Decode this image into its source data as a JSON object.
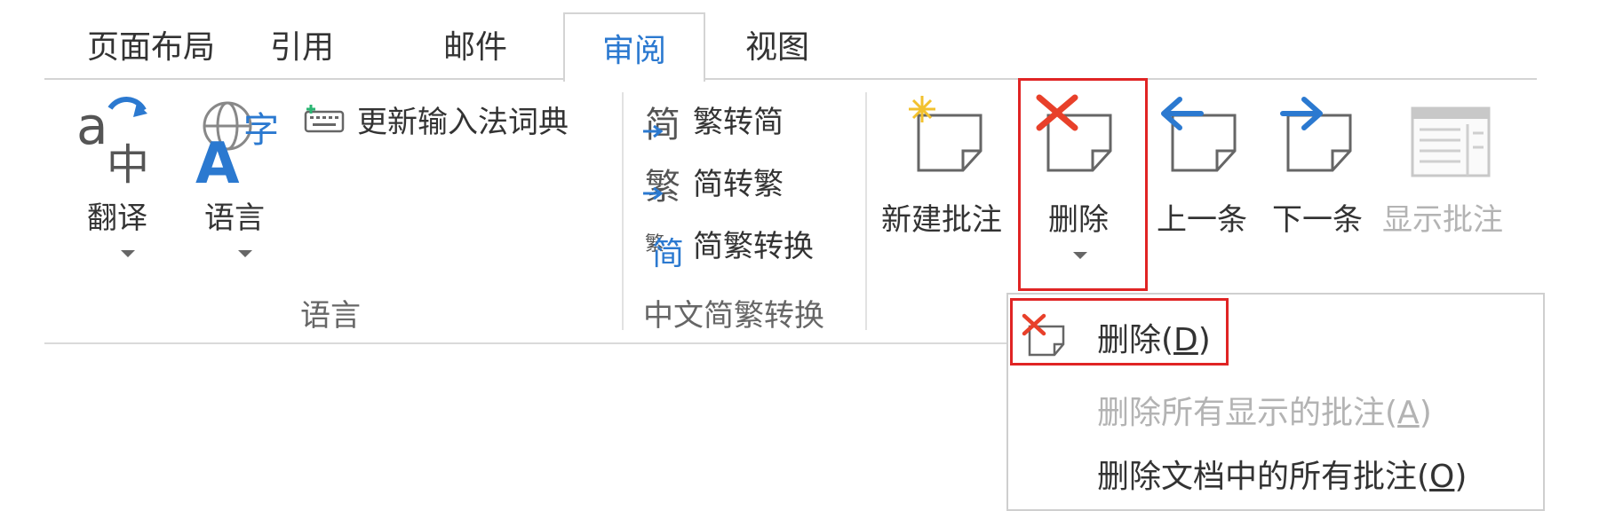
{
  "tabs": [
    {
      "label": "页面布局",
      "active": false
    },
    {
      "label": "引用",
      "active": false
    },
    {
      "label": "邮件",
      "active": false
    },
    {
      "label": "审阅",
      "active": true
    },
    {
      "label": "视图",
      "active": false
    }
  ],
  "language_group": {
    "translate_label": "翻译",
    "language_label": "语言",
    "update_ime_label": "更新输入法词典",
    "group_label": "语言"
  },
  "chinese_group": {
    "to_simplified": "繁转简",
    "to_traditional": "简转繁",
    "convert": "简繁转换",
    "group_label": "中文简繁转换"
  },
  "comments_group": {
    "new_comment": "新建批注",
    "delete": "删除",
    "previous": "上一条",
    "next": "下一条",
    "show_comments": "显示批注"
  },
  "delete_menu": {
    "item1_prefix": "删除(",
    "item1_key": "D",
    "item1_suffix": ")",
    "item2_prefix": "删除所有显示的批注(",
    "item2_key": "A",
    "item2_suffix": ")",
    "item3_prefix": "删除文档中的所有批注(",
    "item3_key": "O",
    "item3_suffix": ")"
  },
  "colors": {
    "accent_blue": "#2b79d0",
    "highlight_red": "#e02424",
    "delete_red": "#e8402a",
    "disabled_gray": "#b3b3b3"
  }
}
